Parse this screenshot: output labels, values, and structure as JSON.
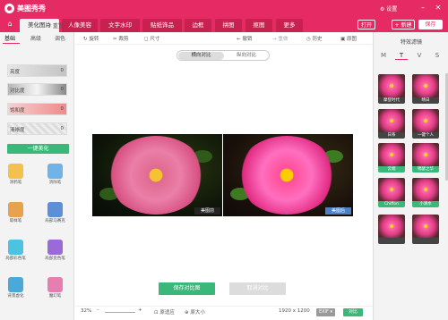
{
  "app": {
    "title": "美图秀秀",
    "settings": "⚙ 设置",
    "minimize": "–",
    "close": "✕"
  },
  "nav": {
    "home_icon": "⌂",
    "tabs": [
      "美化图片",
      "人像美容",
      "文字水印",
      "贴纸饰品",
      "边框",
      "拼图",
      "抠图",
      "更多"
    ],
    "open_btn": "打开",
    "new_btn": "+ 新建",
    "save_btn": "保存"
  },
  "left": {
    "subtabs": [
      "基础",
      "高级",
      "调色"
    ],
    "reset": "↺ 重置",
    "sliders": [
      {
        "label": "亮度",
        "value": "0"
      },
      {
        "label": "对比度",
        "value": "0"
      },
      {
        "label": "饱和度",
        "value": "0"
      },
      {
        "label": "清晰度",
        "value": "0"
      }
    ],
    "one_key": "一键美化",
    "tools": [
      "涂鸦笔",
      "消除笔",
      "取样笔",
      "局部马赛克",
      "局部彩色笔",
      "局部变色笔",
      "背景虚化",
      "魔幻笔"
    ]
  },
  "toolbar": {
    "rotate": "↻ 旋转",
    "crop": "✂ 裁剪",
    "size": "◻ 尺寸",
    "undo": "← 撤销",
    "redo": "→ 重做",
    "history": "◷ 历史",
    "original": "▣ 原图"
  },
  "compare": {
    "horizontal": "横向对比",
    "vertical": "纵向对比",
    "before_tag": "美图前",
    "after_tag": "美图后",
    "save": "保存对比图",
    "cancel": "取消对比"
  },
  "bottom": {
    "zoom": "32%",
    "minus": "–",
    "plus": "+",
    "fit": "⊡ 原适应",
    "actual": "⊕ 原大小",
    "dimensions": "1920 x 1200",
    "exif": "EXIF ▾",
    "compare": "对比"
  },
  "right": {
    "title": "特效滤镜",
    "tabs": [
      "M",
      "T",
      "V",
      "S"
    ],
    "filters": [
      "摩登时代",
      "晴日",
      "日系",
      "一键个人",
      "云端",
      "锦瑟之华",
      "Chiffon",
      "小清水",
      "",
      ""
    ]
  },
  "colors": {
    "accent": "#e52a64",
    "green": "#3ab87a"
  }
}
